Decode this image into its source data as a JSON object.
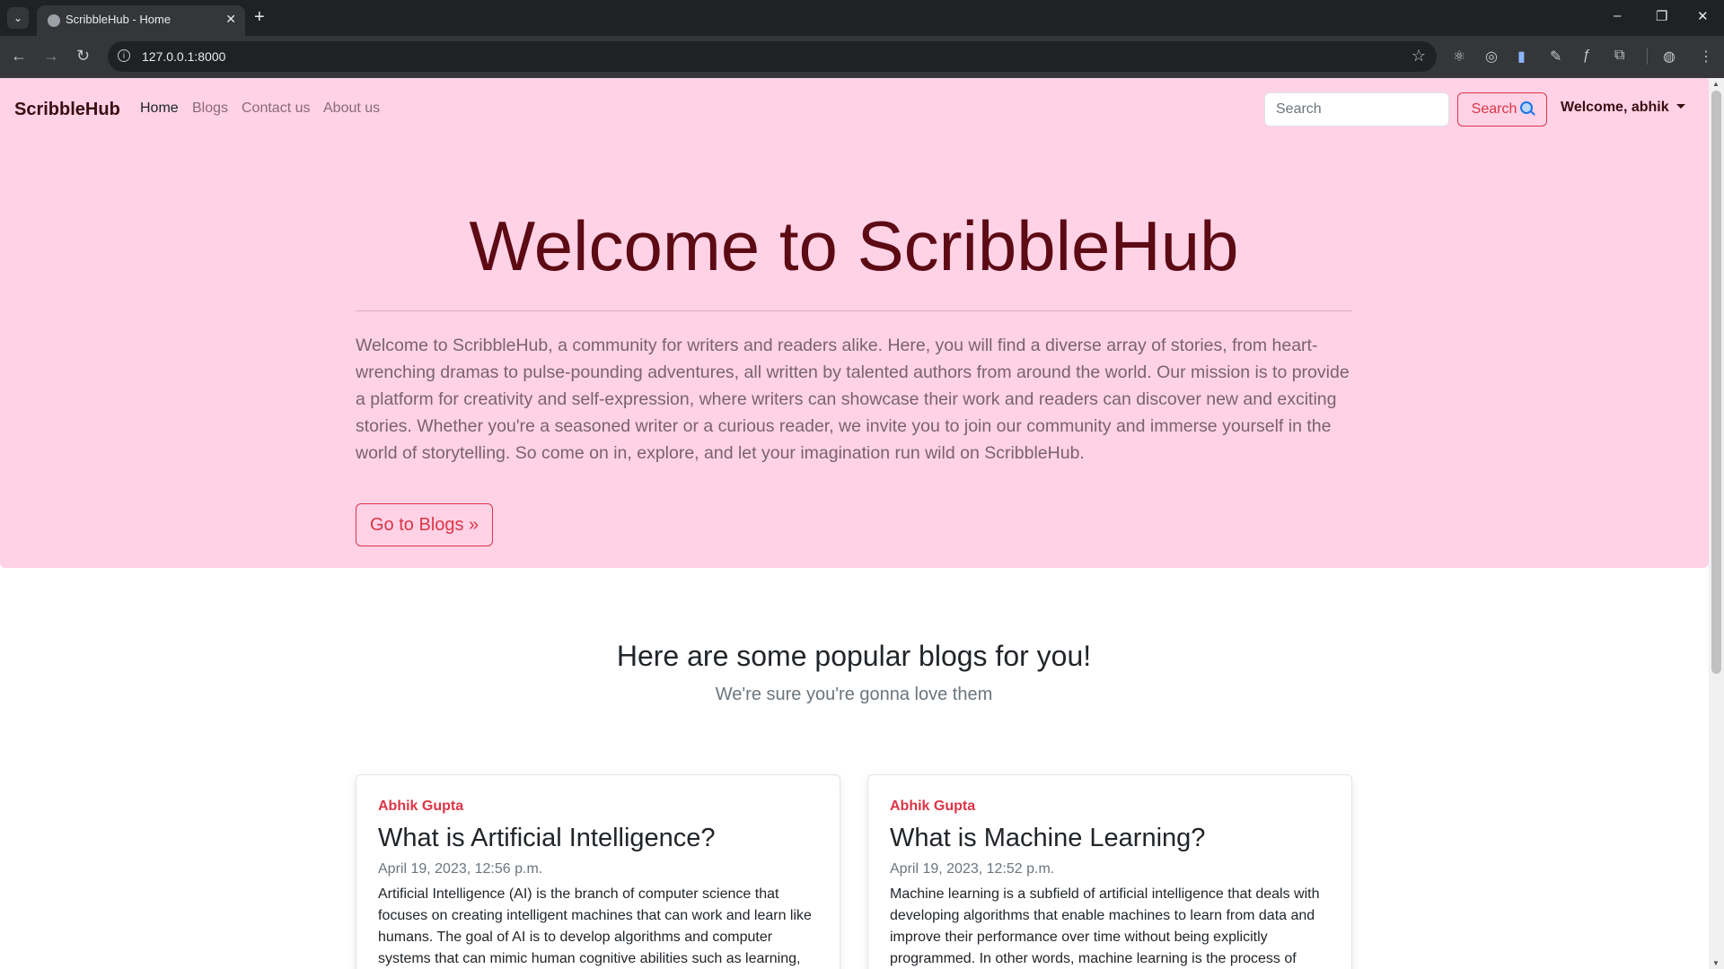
{
  "browser": {
    "tab_title": "ScribbleHub - Home",
    "tab_close": "✕",
    "new_tab": "+",
    "url": "127.0.0.1:8000",
    "window_controls": {
      "minimize": "–",
      "restore": "❐",
      "close": "✕"
    }
  },
  "navbar": {
    "brand": "ScribbleHub",
    "links": [
      "Home",
      "Blogs",
      "Contact us",
      "About us"
    ],
    "search_placeholder": "Search",
    "search_button": "Search",
    "user_menu": "Welcome, abhik"
  },
  "hero": {
    "heading": "Welcome to ScribbleHub",
    "paragraph": "Welcome to ScribbleHub, a community for writers and readers alike. Here, you will find a diverse array of stories, from heart-wrenching dramas to pulse-pounding adventures, all written by talented authors from around the world. Our mission is to provide a platform for creativity and self-expression, where writers can showcase their work and readers can discover new and exciting stories. Whether you're a seasoned writer or a curious reader, we invite you to join our community and immerse yourself in the world of storytelling. So come on in, explore, and let your imagination run wild on ScribbleHub.",
    "button": "Go to Blogs »"
  },
  "popular": {
    "title": "Here are some popular blogs for you!",
    "subtitle": "We're sure you're gonna love them"
  },
  "blogs": [
    {
      "author": "Abhik Gupta",
      "title": "What is Artificial Intelligence?",
      "date": "April 19, 2023, 12:56 p.m.",
      "excerpt": "Artificial Intelligence (AI) is the branch of computer science that focuses on creating intelligent machines that can work and learn like humans. The goal of AI is to develop algorithms and computer systems that can mimic human cognitive abilities such as learning,"
    },
    {
      "author": "Abhik Gupta",
      "title": "What is Machine Learning?",
      "date": "April 19, 2023, 12:52 p.m.",
      "excerpt": "Machine learning is a subfield of artificial intelligence that deals with developing algorithms that enable machines to learn from data and improve their performance over time without being explicitly programmed. In other words, machine learning is the process of"
    }
  ],
  "colors": {
    "navbar_bg": "#ffd2e6",
    "accent": "#dc3545",
    "heading": "#5c0a14"
  }
}
